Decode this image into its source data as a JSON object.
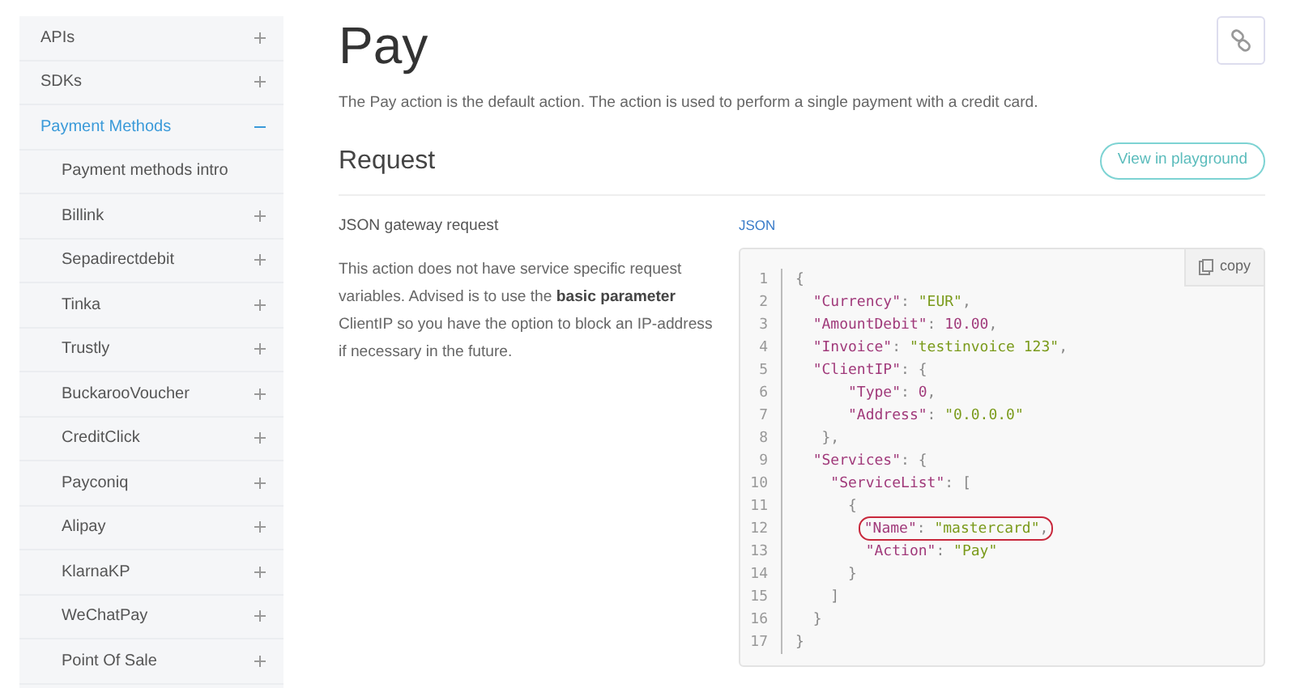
{
  "sidebar": {
    "items": [
      {
        "label": "APIs",
        "kind": "section",
        "expanded": false,
        "selected": false
      },
      {
        "label": "SDKs",
        "kind": "section",
        "expanded": false,
        "selected": false
      },
      {
        "label": "Payment Methods",
        "kind": "section",
        "expanded": true,
        "selected": true,
        "children": [
          {
            "label": "Payment methods intro",
            "kind": "page",
            "selected": false
          },
          {
            "label": "Billink",
            "kind": "section",
            "expanded": false,
            "selected": false
          },
          {
            "label": "Sepadirectdebit",
            "kind": "section",
            "expanded": false,
            "selected": false
          },
          {
            "label": "Tinka",
            "kind": "section",
            "expanded": false,
            "selected": false
          },
          {
            "label": "Trustly",
            "kind": "section",
            "expanded": false,
            "selected": false
          },
          {
            "label": "BuckarooVoucher",
            "kind": "section",
            "expanded": false,
            "selected": false
          },
          {
            "label": "CreditClick",
            "kind": "section",
            "expanded": false,
            "selected": false
          },
          {
            "label": "Payconiq",
            "kind": "section",
            "expanded": false,
            "selected": false
          },
          {
            "label": "Alipay",
            "kind": "section",
            "expanded": false,
            "selected": false
          },
          {
            "label": "KlarnaKP",
            "kind": "section",
            "expanded": false,
            "selected": false
          },
          {
            "label": "WeChatPay",
            "kind": "section",
            "expanded": false,
            "selected": false
          },
          {
            "label": "Point Of Sale",
            "kind": "section",
            "expanded": false,
            "selected": false
          }
        ]
      }
    ]
  },
  "page": {
    "title": "Pay",
    "description": "The Pay action is the default action. The action is used to perform a single payment with a credit card."
  },
  "request": {
    "heading": "Request",
    "playground_button": "View in playground",
    "subtitle": "JSON gateway request",
    "body": "This action does not have service specific request variables. Advised is to use the **basic parameter** ClientIP so you have the option to block an IP-address if necessary in the future.",
    "code_tab": "JSON",
    "copy_button": "copy",
    "code_lines": [
      {
        "number": "1",
        "highlighted": false,
        "tokens": [
          {
            "kind": "punct",
            "text": "{"
          }
        ]
      },
      {
        "number": "2",
        "highlighted": false,
        "tokens": [
          {
            "kind": "key",
            "text": "  \"Currency\""
          },
          {
            "kind": "punct",
            "text": ": "
          },
          {
            "kind": "string",
            "text": "\"EUR\""
          },
          {
            "kind": "punct",
            "text": ","
          }
        ]
      },
      {
        "number": "3",
        "highlighted": false,
        "tokens": [
          {
            "kind": "key",
            "text": "  \"AmountDebit\""
          },
          {
            "kind": "punct",
            "text": ": "
          },
          {
            "kind": "number",
            "text": "10.00"
          },
          {
            "kind": "punct",
            "text": ","
          }
        ]
      },
      {
        "number": "4",
        "highlighted": false,
        "tokens": [
          {
            "kind": "key",
            "text": "  \"Invoice\""
          },
          {
            "kind": "punct",
            "text": ": "
          },
          {
            "kind": "string",
            "text": "\"testinvoice 123\""
          },
          {
            "kind": "punct",
            "text": ","
          }
        ]
      },
      {
        "number": "5",
        "highlighted": false,
        "tokens": [
          {
            "kind": "key",
            "text": "  \"ClientIP\""
          },
          {
            "kind": "punct",
            "text": ": {"
          }
        ]
      },
      {
        "number": "6",
        "highlighted": false,
        "tokens": [
          {
            "kind": "key",
            "text": "      \"Type\""
          },
          {
            "kind": "punct",
            "text": ": "
          },
          {
            "kind": "number",
            "text": "0"
          },
          {
            "kind": "punct",
            "text": ","
          }
        ]
      },
      {
        "number": "7",
        "highlighted": false,
        "tokens": [
          {
            "kind": "key",
            "text": "      \"Address\""
          },
          {
            "kind": "punct",
            "text": ": "
          },
          {
            "kind": "string",
            "text": "\"0.0.0.0\""
          }
        ]
      },
      {
        "number": "8",
        "highlighted": false,
        "tokens": [
          {
            "kind": "punct",
            "text": "   },"
          }
        ]
      },
      {
        "number": "9",
        "highlighted": false,
        "tokens": [
          {
            "kind": "key",
            "text": "  \"Services\""
          },
          {
            "kind": "punct",
            "text": ": {"
          }
        ]
      },
      {
        "number": "10",
        "highlighted": false,
        "tokens": [
          {
            "kind": "key",
            "text": "    \"ServiceList\""
          },
          {
            "kind": "punct",
            "text": ": ["
          }
        ]
      },
      {
        "number": "11",
        "highlighted": false,
        "tokens": [
          {
            "kind": "punct",
            "text": "      {"
          }
        ]
      },
      {
        "number": "12",
        "highlighted": true,
        "tokens": [
          {
            "kind": "key",
            "text": "        \"Name\""
          },
          {
            "kind": "punct",
            "text": ": "
          },
          {
            "kind": "string",
            "text": "\"mastercard\""
          },
          {
            "kind": "punct",
            "text": ","
          }
        ]
      },
      {
        "number": "13",
        "highlighted": false,
        "tokens": [
          {
            "kind": "key",
            "text": "        \"Action\""
          },
          {
            "kind": "punct",
            "text": ": "
          },
          {
            "kind": "string",
            "text": "\"Pay\""
          }
        ]
      },
      {
        "number": "14",
        "highlighted": false,
        "tokens": [
          {
            "kind": "punct",
            "text": "      }"
          }
        ]
      },
      {
        "number": "15",
        "highlighted": false,
        "tokens": [
          {
            "kind": "punct",
            "text": "    ]"
          }
        ]
      },
      {
        "number": "16",
        "highlighted": false,
        "tokens": [
          {
            "kind": "punct",
            "text": "  }"
          }
        ]
      },
      {
        "number": "17",
        "highlighted": false,
        "tokens": [
          {
            "kind": "punct",
            "text": "}"
          }
        ]
      }
    ]
  }
}
